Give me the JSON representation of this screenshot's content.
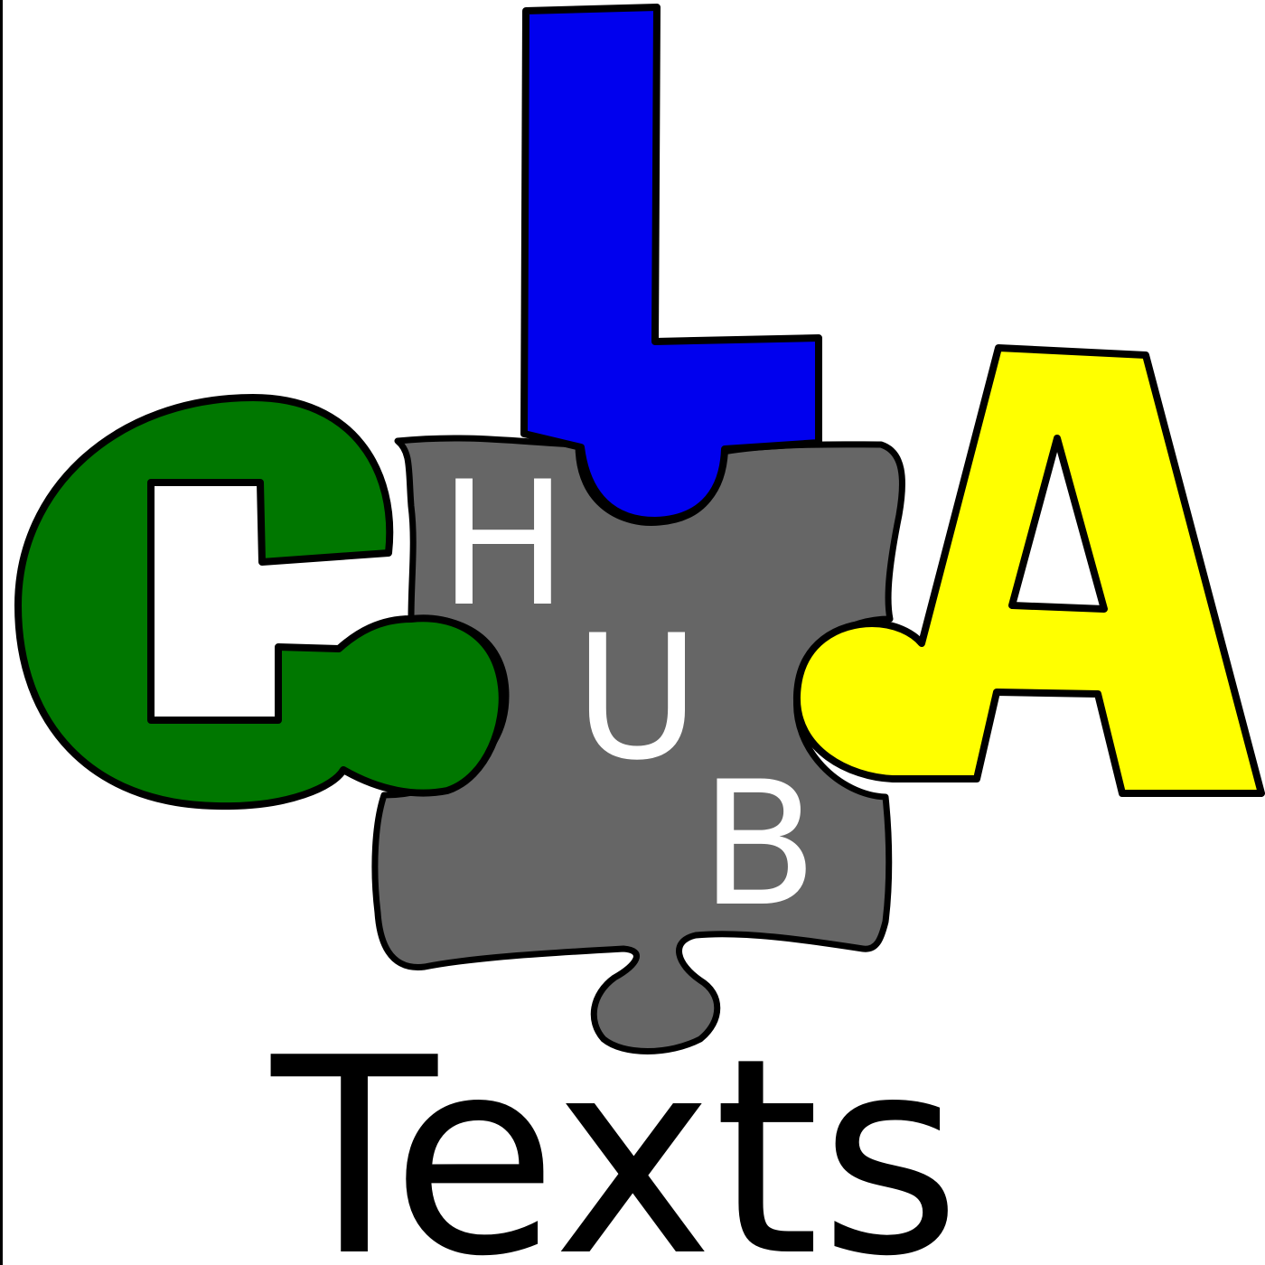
{
  "logo": {
    "letters": [
      "C",
      "L",
      "A"
    ],
    "hub": [
      "H",
      "U",
      "B"
    ],
    "caption": "Texts",
    "colors": {
      "c_piece": "#007700",
      "l_piece": "#0000ee",
      "a_piece": "#ffff00",
      "hub_piece": "#666666",
      "outline": "#000000",
      "hub_text": "#ffffff",
      "background": "#ffffff"
    }
  }
}
